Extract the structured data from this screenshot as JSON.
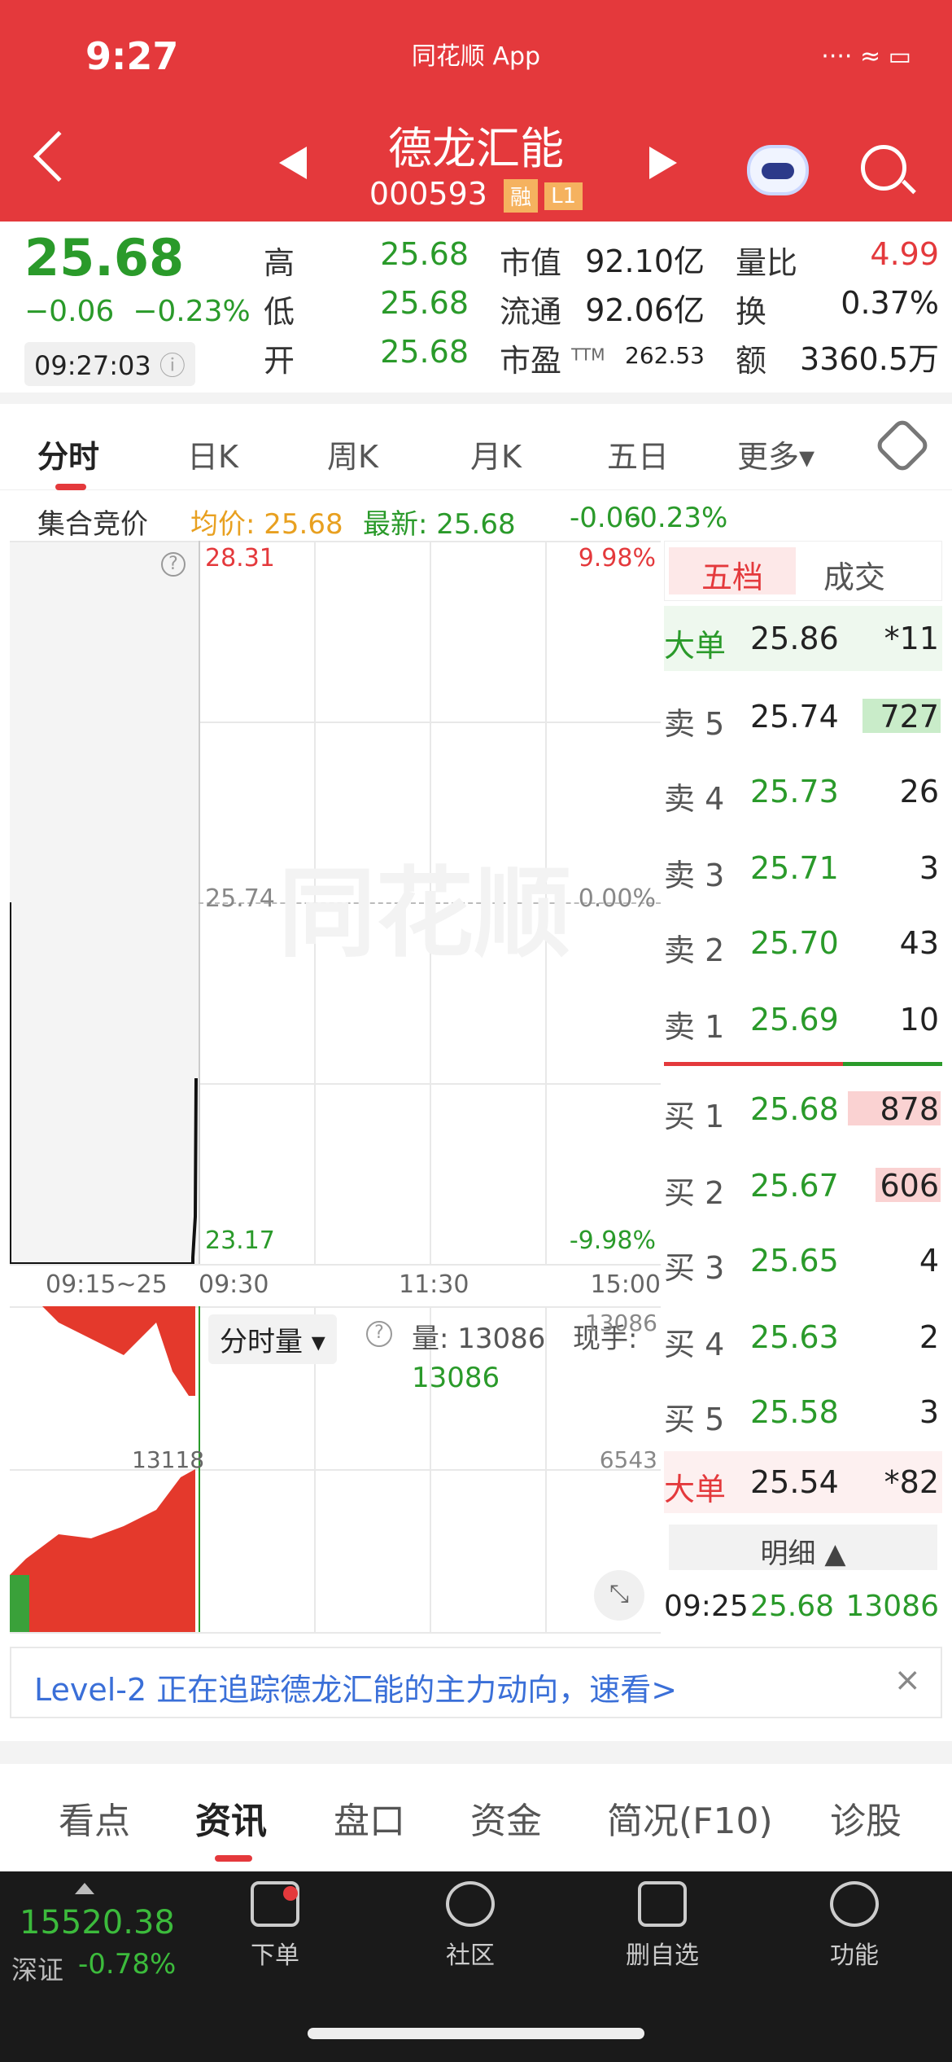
{
  "status": {
    "time": "9:27",
    "app": "同花顺 App"
  },
  "header": {
    "title": "德龙汇能",
    "code": "000593",
    "tag1": "融",
    "tag2": "L1"
  },
  "quote": {
    "price": "25.68",
    "change": "−0.06",
    "change_pct": "−0.23%",
    "time": "09:27:03",
    "high_label": "高",
    "high": "25.68",
    "low_label": "低",
    "low": "25.68",
    "open_label": "开",
    "open": "25.68",
    "mktcap_label": "市值",
    "mktcap": "92.10亿",
    "float_label": "流通",
    "float": "92.06亿",
    "pe_label": "市盈",
    "pe_sup": "TTM",
    "pe": "262.53",
    "vr_label": "量比",
    "vr": "4.99",
    "turnover_label": "换",
    "turnover": "0.37%",
    "amount_label": "额",
    "amount": "3360.5万"
  },
  "tabs": [
    "分时",
    "日K",
    "周K",
    "月K",
    "五日",
    "更多▾"
  ],
  "subinfo": {
    "label": "集合竞价",
    "avg": "均价: 25.68",
    "latest": "最新: 25.68",
    "chg": "-0.06",
    "pct": "-0.23%"
  },
  "chart": {
    "top_price": "28.31",
    "top_pct": "9.98%",
    "mid_price": "25.74",
    "mid_pct": "0.00%",
    "bot_price": "23.17",
    "bot_pct": "-9.98%",
    "watermark": "同花顺",
    "x_labels": [
      "09:15~25",
      "09:30",
      "11:30",
      "15:00"
    ],
    "vol_select": "分时量",
    "vol_label": "量: 13086",
    "vol_value": "13086",
    "now_label": "现手:",
    "vol_max": "13086",
    "vol_mid": "6543",
    "auction_max": "13118"
  },
  "book": {
    "tab_active": "五档",
    "tab_other": "成交",
    "big_sell": {
      "label": "大单",
      "price": "25.86",
      "vol": "*11"
    },
    "asks": [
      {
        "label": "卖 5",
        "price": "25.74",
        "vol": "727"
      },
      {
        "label": "卖 4",
        "price": "25.73",
        "vol": "26"
      },
      {
        "label": "卖 3",
        "price": "25.71",
        "vol": "3"
      },
      {
        "label": "卖 2",
        "price": "25.70",
        "vol": "43"
      },
      {
        "label": "卖 1",
        "price": "25.69",
        "vol": "10"
      }
    ],
    "bids": [
      {
        "label": "买 1",
        "price": "25.68",
        "vol": "878"
      },
      {
        "label": "买 2",
        "price": "25.67",
        "vol": "606"
      },
      {
        "label": "买 3",
        "price": "25.65",
        "vol": "4"
      },
      {
        "label": "买 4",
        "price": "25.63",
        "vol": "2"
      },
      {
        "label": "买 5",
        "price": "25.58",
        "vol": "3"
      }
    ],
    "big_buy": {
      "label": "大单",
      "price": "25.54",
      "vol": "*82"
    },
    "detail_label": "明细 ▲",
    "trade": {
      "time": "09:25",
      "price": "25.68",
      "vol": "13086"
    }
  },
  "banner": {
    "text": "Level-2 正在追踪德龙汇能的主力动向，速看>",
    "close": "×"
  },
  "tabs2": [
    "看点",
    "资讯",
    "盘口",
    "资金",
    "简况(F10)",
    "诊股"
  ],
  "bottombar": {
    "index_value": "15520.38",
    "index_name": "深证",
    "index_pct": "-0.78%",
    "items": [
      "下单",
      "社区",
      "删自选",
      "功能"
    ]
  }
}
